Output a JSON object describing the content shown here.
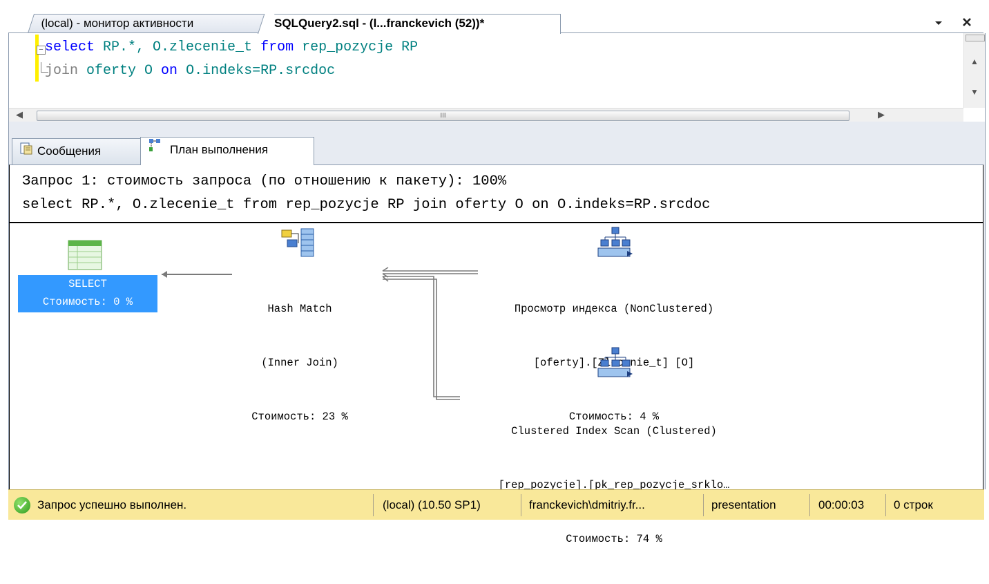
{
  "tabs": [
    {
      "label": "(local) - монитор активности",
      "active": false
    },
    {
      "label": "SQLQuery2.sql - (l...franckevich (52))*",
      "active": true
    }
  ],
  "tabstrip": {
    "dropdown_icon": "chevron-down-icon",
    "close_icon": "close-icon"
  },
  "editor": {
    "line1": {
      "kw1": "select",
      "t1": " RP.*, O.zlecenie_t ",
      "kw2": "from",
      "t2": " rep_pozycje RP"
    },
    "line2": {
      "t1": "join",
      "t2": " oferty O ",
      "kw1": "on",
      "t3": " O.indeks=RP.srcdoc"
    },
    "hscroll_grip": "III"
  },
  "results": {
    "tabs": [
      {
        "label": "Сообщения",
        "icon": "messages-icon"
      },
      {
        "label": "План выполнения",
        "icon": "execution-plan-icon"
      }
    ],
    "query_title": "Запрос 1: стоимость запроса (по отношению к пакету): 100%",
    "query_text": "select RP.*, O.zlecenie_t from rep_pozycje RP join oferty O on O.indeks=RP.srcdoc",
    "nodes": {
      "select": {
        "line1": "SELECT",
        "line2": "Стоимость: 0 %",
        "icon": "select-table-icon"
      },
      "hash": {
        "line1": "Hash Match",
        "line2": "(Inner Join)",
        "line3": "Стоимость: 23 %",
        "icon": "hash-match-icon"
      },
      "ix1": {
        "line1": "Просмотр индекса (NonClustered)",
        "line2": "[oferty].[Zlecenie_t] [O]",
        "line3": "Стоимость: 4 %",
        "icon": "index-scan-icon"
      },
      "ix2": {
        "line1": "Clustered Index Scan (Clustered)",
        "line2": "[rep_pozycje].[pk_rep_pozycje_srklo…",
        "line3": "Стоимость: 74 %",
        "icon": "clustered-index-scan-icon"
      }
    }
  },
  "status": {
    "message": "Запрос успешно выполнен.",
    "server": "(local) (10.50 SP1)",
    "user": "franckevich\\dmitriy.fr...",
    "database": "presentation",
    "elapsed": "00:00:03",
    "rows": "0 строк",
    "icon": "success-check-icon"
  },
  "colors": {
    "status_bar": "#f9e89a",
    "selected_node": "#3399ff",
    "keyword": "#0000ff",
    "identifier": "#008080"
  }
}
